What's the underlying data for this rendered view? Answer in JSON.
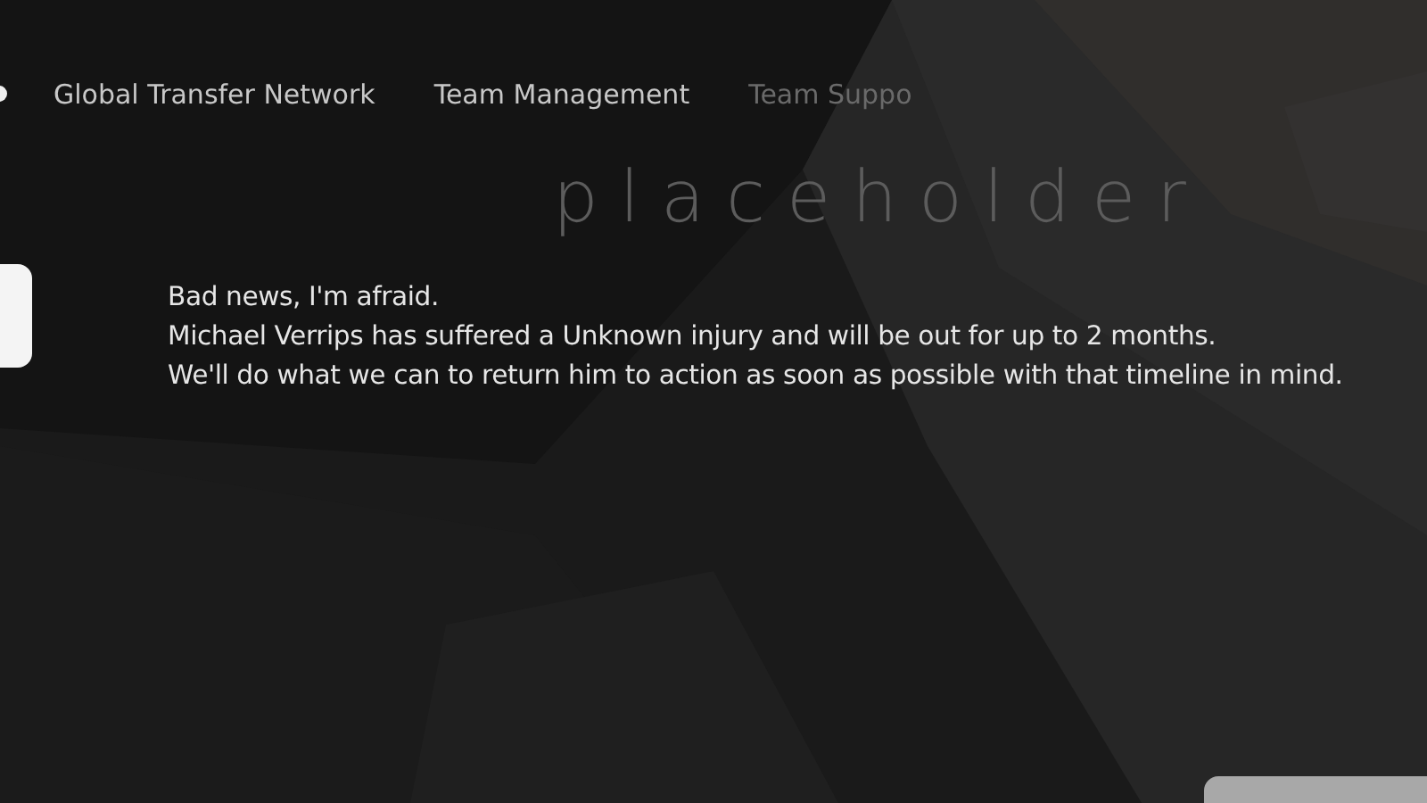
{
  "tabs": [
    {
      "label": "Global Transfer Network",
      "dimmed": false
    },
    {
      "label": "Team Management",
      "dimmed": false
    },
    {
      "label": "Team Suppo",
      "dimmed": true
    }
  ],
  "backdrop_text": "placeholder",
  "message": {
    "lines": [
      "Bad news, I'm afraid.",
      "Michael Verrips has suffered a Unknown injury and will be out for up to 2 months.",
      "We'll do what we can to return him to action as soon as possible with that timeline in mind."
    ]
  }
}
